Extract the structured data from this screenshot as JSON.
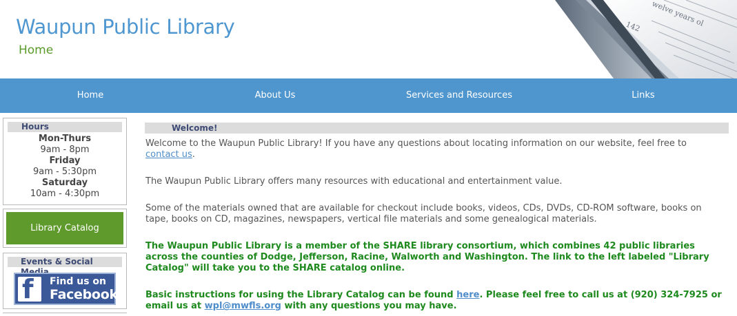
{
  "header": {
    "site_title": "Waupun Public Library",
    "page_subtitle": "Home",
    "book_page_number": "142",
    "book_text_fragment": "welve years ol"
  },
  "nav": {
    "items": [
      {
        "label": "Home"
      },
      {
        "label": "About Us"
      },
      {
        "label": "Services and Resources"
      },
      {
        "label": "Links"
      }
    ]
  },
  "sidebar": {
    "hours": {
      "title": "Hours",
      "lines": [
        {
          "day": "Mon-Thurs",
          "time": "9am - 8pm"
        },
        {
          "day": "Friday",
          "time": "9am - 5:30pm"
        },
        {
          "day": "Saturday",
          "time": "10am - 4:30pm"
        }
      ]
    },
    "catalog_label": "Library Catalog",
    "social": {
      "title": "Events & Social Media",
      "fb_line1": "Find us on",
      "fb_line2": "Facebook",
      "fb_letter": "f"
    }
  },
  "main": {
    "welcome_title": "Welcome!",
    "p1_text": "Welcome to the Waupun Public Library! If you have any questions about locating information on our website, feel free to",
    "p1_link": "contact us",
    "p1_end": ".",
    "p2": "The Waupun Public Library offers many resources with educational and entertainment value.",
    "p3": "Some of the materials owned that are available for checkout include books, videos, CDs, DVDs, CD-ROM software, books on tape, books on CD, magazines, newspapers, vertical file materials and some genealogical materials.",
    "p4": "The Waupun Public Library is a member of the SHARE library consortium, which combines 42 public libraries across the counties of Dodge, Jefferson, Racine, Walworth and Washington.  The link to the left labeled \"Library Catalog\" will take you to the SHARE catalog online.",
    "p5_a": "Basic instructions for using the Library Catalog can be found",
    "p5_link1": "here",
    "p5_b": ".  Please feel free to call us at (920) 324-7925 or email us at",
    "p5_link2": "wpl@mwfls.org",
    "p5_c": "with any questions you may have."
  },
  "colors": {
    "accent_blue": "#4f96cf",
    "title_blue": "#4e97d1",
    "green": "#5f9a2c",
    "facebook": "#3b5998"
  }
}
